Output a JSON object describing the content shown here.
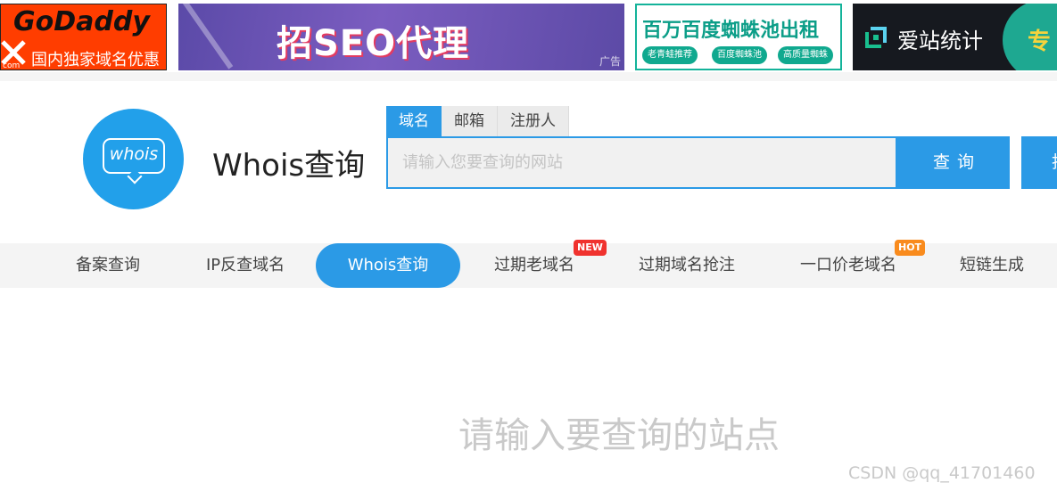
{
  "ads": {
    "godaddy": {
      "title": "GoDaddy",
      "subtitle": "国内独家域名优惠",
      "com": "com"
    },
    "seo": {
      "text": "招SEO代理",
      "tag": "广告"
    },
    "spider": {
      "title": "百万百度蜘蛛池出租",
      "pills": [
        "老青蛙推荐",
        "百度蜘蛛池",
        "高质量蜘蛛"
      ]
    },
    "aizhan": {
      "text": "爱站统计",
      "more": "专"
    }
  },
  "brand": {
    "logo_text": "whois",
    "title": "Whois查询"
  },
  "search": {
    "tabs": [
      {
        "label": "域名",
        "active": true
      },
      {
        "label": "邮箱",
        "active": false
      },
      {
        "label": "注册人",
        "active": false
      }
    ],
    "placeholder": "请输入您要查询的网站",
    "value": "",
    "button": "查询",
    "extra_button": "批"
  },
  "nav": {
    "items": [
      {
        "label": "备案查询"
      },
      {
        "label": "IP反查域名"
      },
      {
        "label": "Whois查询",
        "active": true
      },
      {
        "label": "过期老域名",
        "badge": "NEW"
      },
      {
        "label": "过期域名抢注"
      },
      {
        "label": "一口价老域名",
        "badge": "HOT"
      },
      {
        "label": "短链生成"
      }
    ]
  },
  "main": {
    "prompt": "请输入要查询的站点"
  },
  "watermark": "CSDN @qq_41701460",
  "colors": {
    "accent": "#2b9ae6",
    "badge_new": "#f0322e",
    "badge_hot": "#f98b1d"
  }
}
